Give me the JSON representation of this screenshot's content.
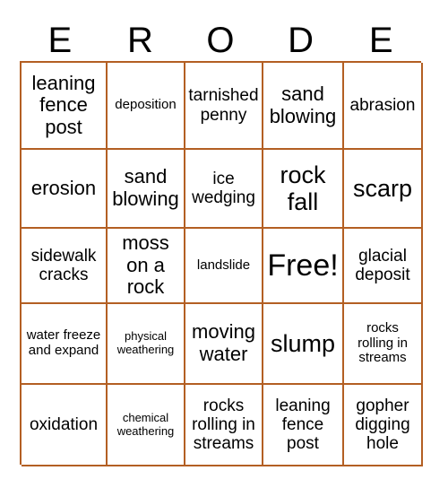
{
  "header": {
    "letters": [
      "E",
      "R",
      "O",
      "D",
      "E"
    ]
  },
  "colors": {
    "border": "#b35f23",
    "text": "#000000",
    "background": "#ffffff"
  },
  "grid": {
    "columns": 5,
    "rows": 5,
    "cells": [
      [
        {
          "label": "leaning fence post",
          "size": "l"
        },
        {
          "label": "deposition",
          "size": "s"
        },
        {
          "label": "tarnished penny",
          "size": "m"
        },
        {
          "label": "sand blowing",
          "size": "l"
        },
        {
          "label": "abrasion",
          "size": "m"
        }
      ],
      [
        {
          "label": "erosion",
          "size": "l"
        },
        {
          "label": "sand blowing",
          "size": "l"
        },
        {
          "label": "ice wedging",
          "size": "m"
        },
        {
          "label": "rock fall",
          "size": "xl"
        },
        {
          "label": "scarp",
          "size": "xl"
        }
      ],
      [
        {
          "label": "sidewalk cracks",
          "size": "m"
        },
        {
          "label": "moss on a rock",
          "size": "l"
        },
        {
          "label": "landslide",
          "size": "s"
        },
        {
          "label": "Free!",
          "size": "xxl"
        },
        {
          "label": "glacial deposit",
          "size": "m"
        }
      ],
      [
        {
          "label": "water freeze and expand",
          "size": "s"
        },
        {
          "label": "physical weathering",
          "size": "xs"
        },
        {
          "label": "moving water",
          "size": "l"
        },
        {
          "label": "slump",
          "size": "xl"
        },
        {
          "label": "rocks rolling in streams",
          "size": "s"
        }
      ],
      [
        {
          "label": "oxidation",
          "size": "m"
        },
        {
          "label": "chemical weathering",
          "size": "xs"
        },
        {
          "label": "rocks rolling in streams",
          "size": "m"
        },
        {
          "label": "leaning fence post",
          "size": "m"
        },
        {
          "label": "gopher digging hole",
          "size": "m"
        }
      ]
    ]
  }
}
